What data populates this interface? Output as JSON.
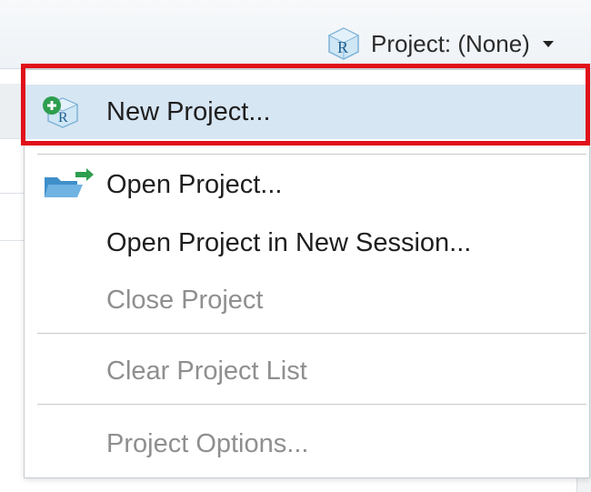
{
  "toolbar": {
    "project_label": "Project: (None)",
    "project_icon": "r-project-cube-icon"
  },
  "menu": {
    "items": [
      {
        "label": "New Project...",
        "icon": "new-project-icon",
        "enabled": true,
        "highlighted": true
      },
      {
        "label": "Open Project...",
        "icon": "open-folder-icon",
        "enabled": true
      },
      {
        "label": "Open Project in New Session...",
        "icon": "",
        "enabled": true
      },
      {
        "label": "Close Project",
        "icon": "",
        "enabled": false
      },
      {
        "label": "Clear Project List",
        "icon": "",
        "enabled": false
      },
      {
        "label": "Project Options...",
        "icon": "",
        "enabled": false
      }
    ]
  },
  "colors": {
    "highlight_row": "#d7e6f3",
    "annotation_box": "#e0101a",
    "disabled_text": "#8f8f8f"
  }
}
